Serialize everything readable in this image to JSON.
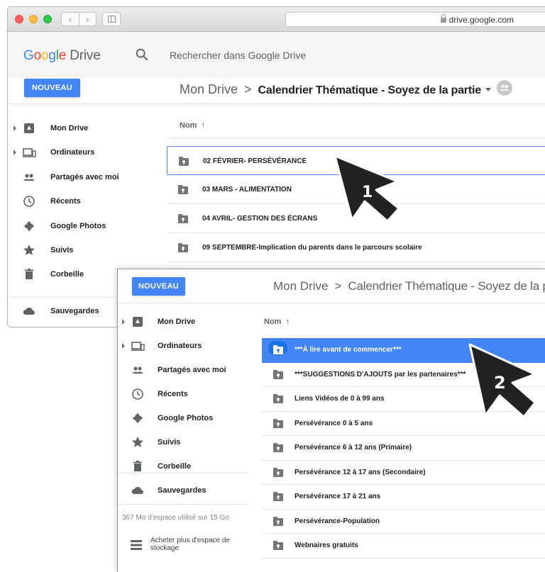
{
  "browser": {
    "url": "drive.google.com",
    "back_glyph": "‹",
    "forward_glyph": "›"
  },
  "app": {
    "logo_google": "Google",
    "logo_drive": "Drive",
    "search_placeholder": "Rechercher dans Google Drive",
    "new_button": "NOUVEAU"
  },
  "window1": {
    "breadcrumb_root": "Mon Drive",
    "breadcrumb_separator": ">",
    "breadcrumb_current": "Calendrier Thématique - Soyez de la partie",
    "sidebar": [
      {
        "label": "Mon Drive",
        "icon": "drive-icon",
        "expandable": true
      },
      {
        "label": "Ordinateurs",
        "icon": "computer-icon",
        "expandable": true
      },
      {
        "label": "Partagés avec moi",
        "icon": "people-icon",
        "expandable": false
      },
      {
        "label": "Récents",
        "icon": "clock-icon",
        "expandable": false
      },
      {
        "label": "Google Photos",
        "icon": "photos-icon",
        "expandable": false
      },
      {
        "label": "Suivis",
        "icon": "star-icon",
        "expandable": false
      },
      {
        "label": "Corbeille",
        "icon": "trash-icon",
        "expandable": false
      },
      {
        "label": "Sauvegardes",
        "icon": "cloud-icon",
        "expandable": false
      }
    ],
    "column_header": "Nom",
    "sort_glyph": "↑",
    "files": [
      "02 FÉVRIER- PERSÉVÉRANCE",
      "03 MARS - ALIMENTATION",
      "04 AVRIL- GESTION DES ÉCRANS",
      "09 SEPTEMBRE-Implication du parents dans le parcours scolaire"
    ],
    "selected_index": 0,
    "step_label": "1"
  },
  "window2": {
    "breadcrumb_root": "Mon Drive",
    "breadcrumb_separator": ">",
    "breadcrumb_current": "Calendrier Thématique - Soyez de la parti",
    "sidebar": [
      {
        "label": "Mon Drive",
        "icon": "drive-icon",
        "expandable": true
      },
      {
        "label": "Ordinateurs",
        "icon": "computer-icon",
        "expandable": true
      },
      {
        "label": "Partagés avec moi",
        "icon": "people-icon",
        "expandable": false
      },
      {
        "label": "Récents",
        "icon": "clock-icon",
        "expandable": false
      },
      {
        "label": "Google Photos",
        "icon": "photos-icon",
        "expandable": false
      },
      {
        "label": "Suivis",
        "icon": "star-icon",
        "expandable": false
      },
      {
        "label": "Corbeille",
        "icon": "trash-icon",
        "expandable": false
      },
      {
        "label": "Sauvegardes",
        "icon": "cloud-icon",
        "expandable": false
      }
    ],
    "storage_text": "367 Mo d'espace utilisé sur 15 Go",
    "buy_storage_line1": "Acheter plus d'espace de",
    "buy_storage_line2": "stockage",
    "column_header": "Nom",
    "sort_glyph": "↑",
    "files": [
      "***À lire avant de commencer***",
      "***SUGGESTIONS D'AJOUTS par les partenaires***",
      "Liens Vidéos de 0 à 99 ans",
      "Persévérance 0 à 5 ans",
      "Persévérance 6 à 12 ans (Primaire)",
      "Persévérance 12 à 17 ans (Secondaire)",
      "Persévérance 17 à 21 ans",
      "Persévérance-Population",
      "Webnaires gratuits"
    ],
    "selected_index": 0,
    "step_label": "2"
  },
  "colors": {
    "accent_blue": "#4285f4",
    "selection_outline": "#4d90fe",
    "google_blue": "#4285f4",
    "google_red": "#ea4335",
    "google_yellow": "#fbbc05",
    "google_green": "#34a853"
  }
}
